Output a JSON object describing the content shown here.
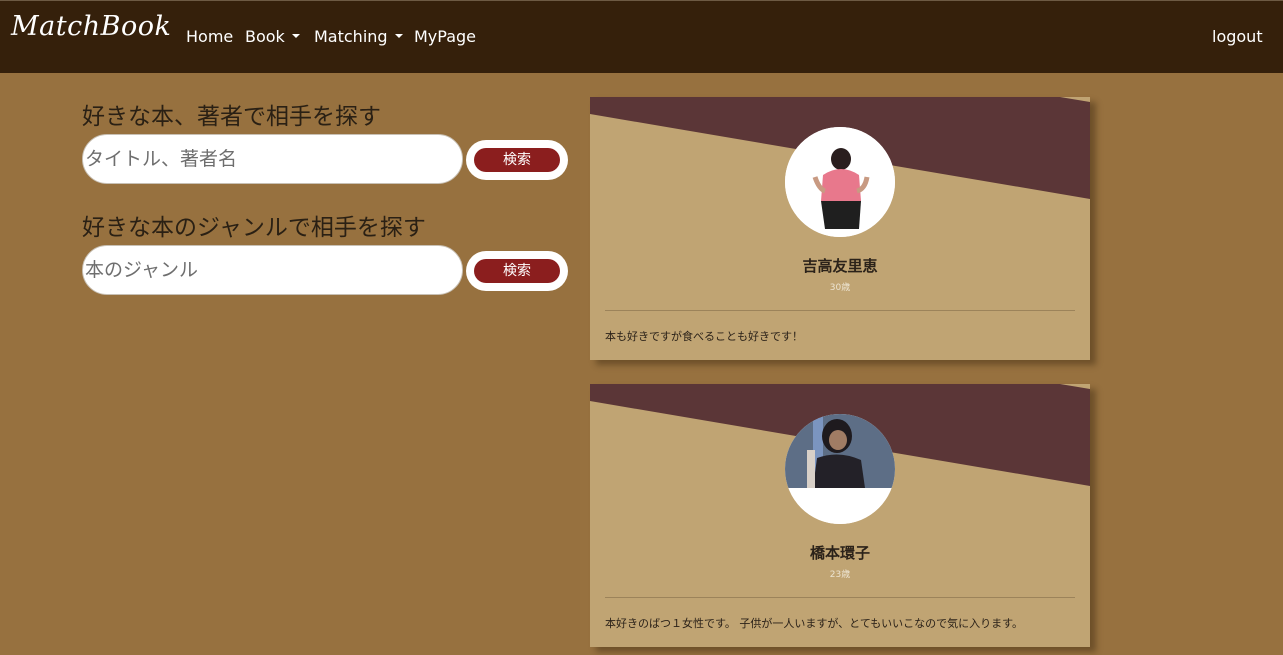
{
  "nav": {
    "brand": "MatchBook",
    "home": "Home",
    "book": "Book",
    "matching": "Matching",
    "mypage": "MyPage",
    "logout": "logout"
  },
  "search": {
    "by_title": {
      "heading": "好きな本、著者で相手を探す",
      "placeholder": "タイトル、著者名",
      "button": "検索"
    },
    "by_genre": {
      "heading": "好きな本のジャンルで相手を探す",
      "placeholder": "本のジャンル",
      "button": "検索"
    }
  },
  "users": [
    {
      "name": "吉高友里恵",
      "age": "30歳",
      "bio": "本も好きですが食べることも好きです！"
    },
    {
      "name": "橋本環子",
      "age": "23歳",
      "bio": "本好きのばつ１女性です。 子供が一人いますが、とてもいいこなので気に入ります。"
    }
  ],
  "colors": {
    "page_bg": "#97713f",
    "navbar_bg": "#35200b",
    "card_bg": "#c0a473",
    "card_band": "#5b3637",
    "button": "#8b1e1e"
  }
}
